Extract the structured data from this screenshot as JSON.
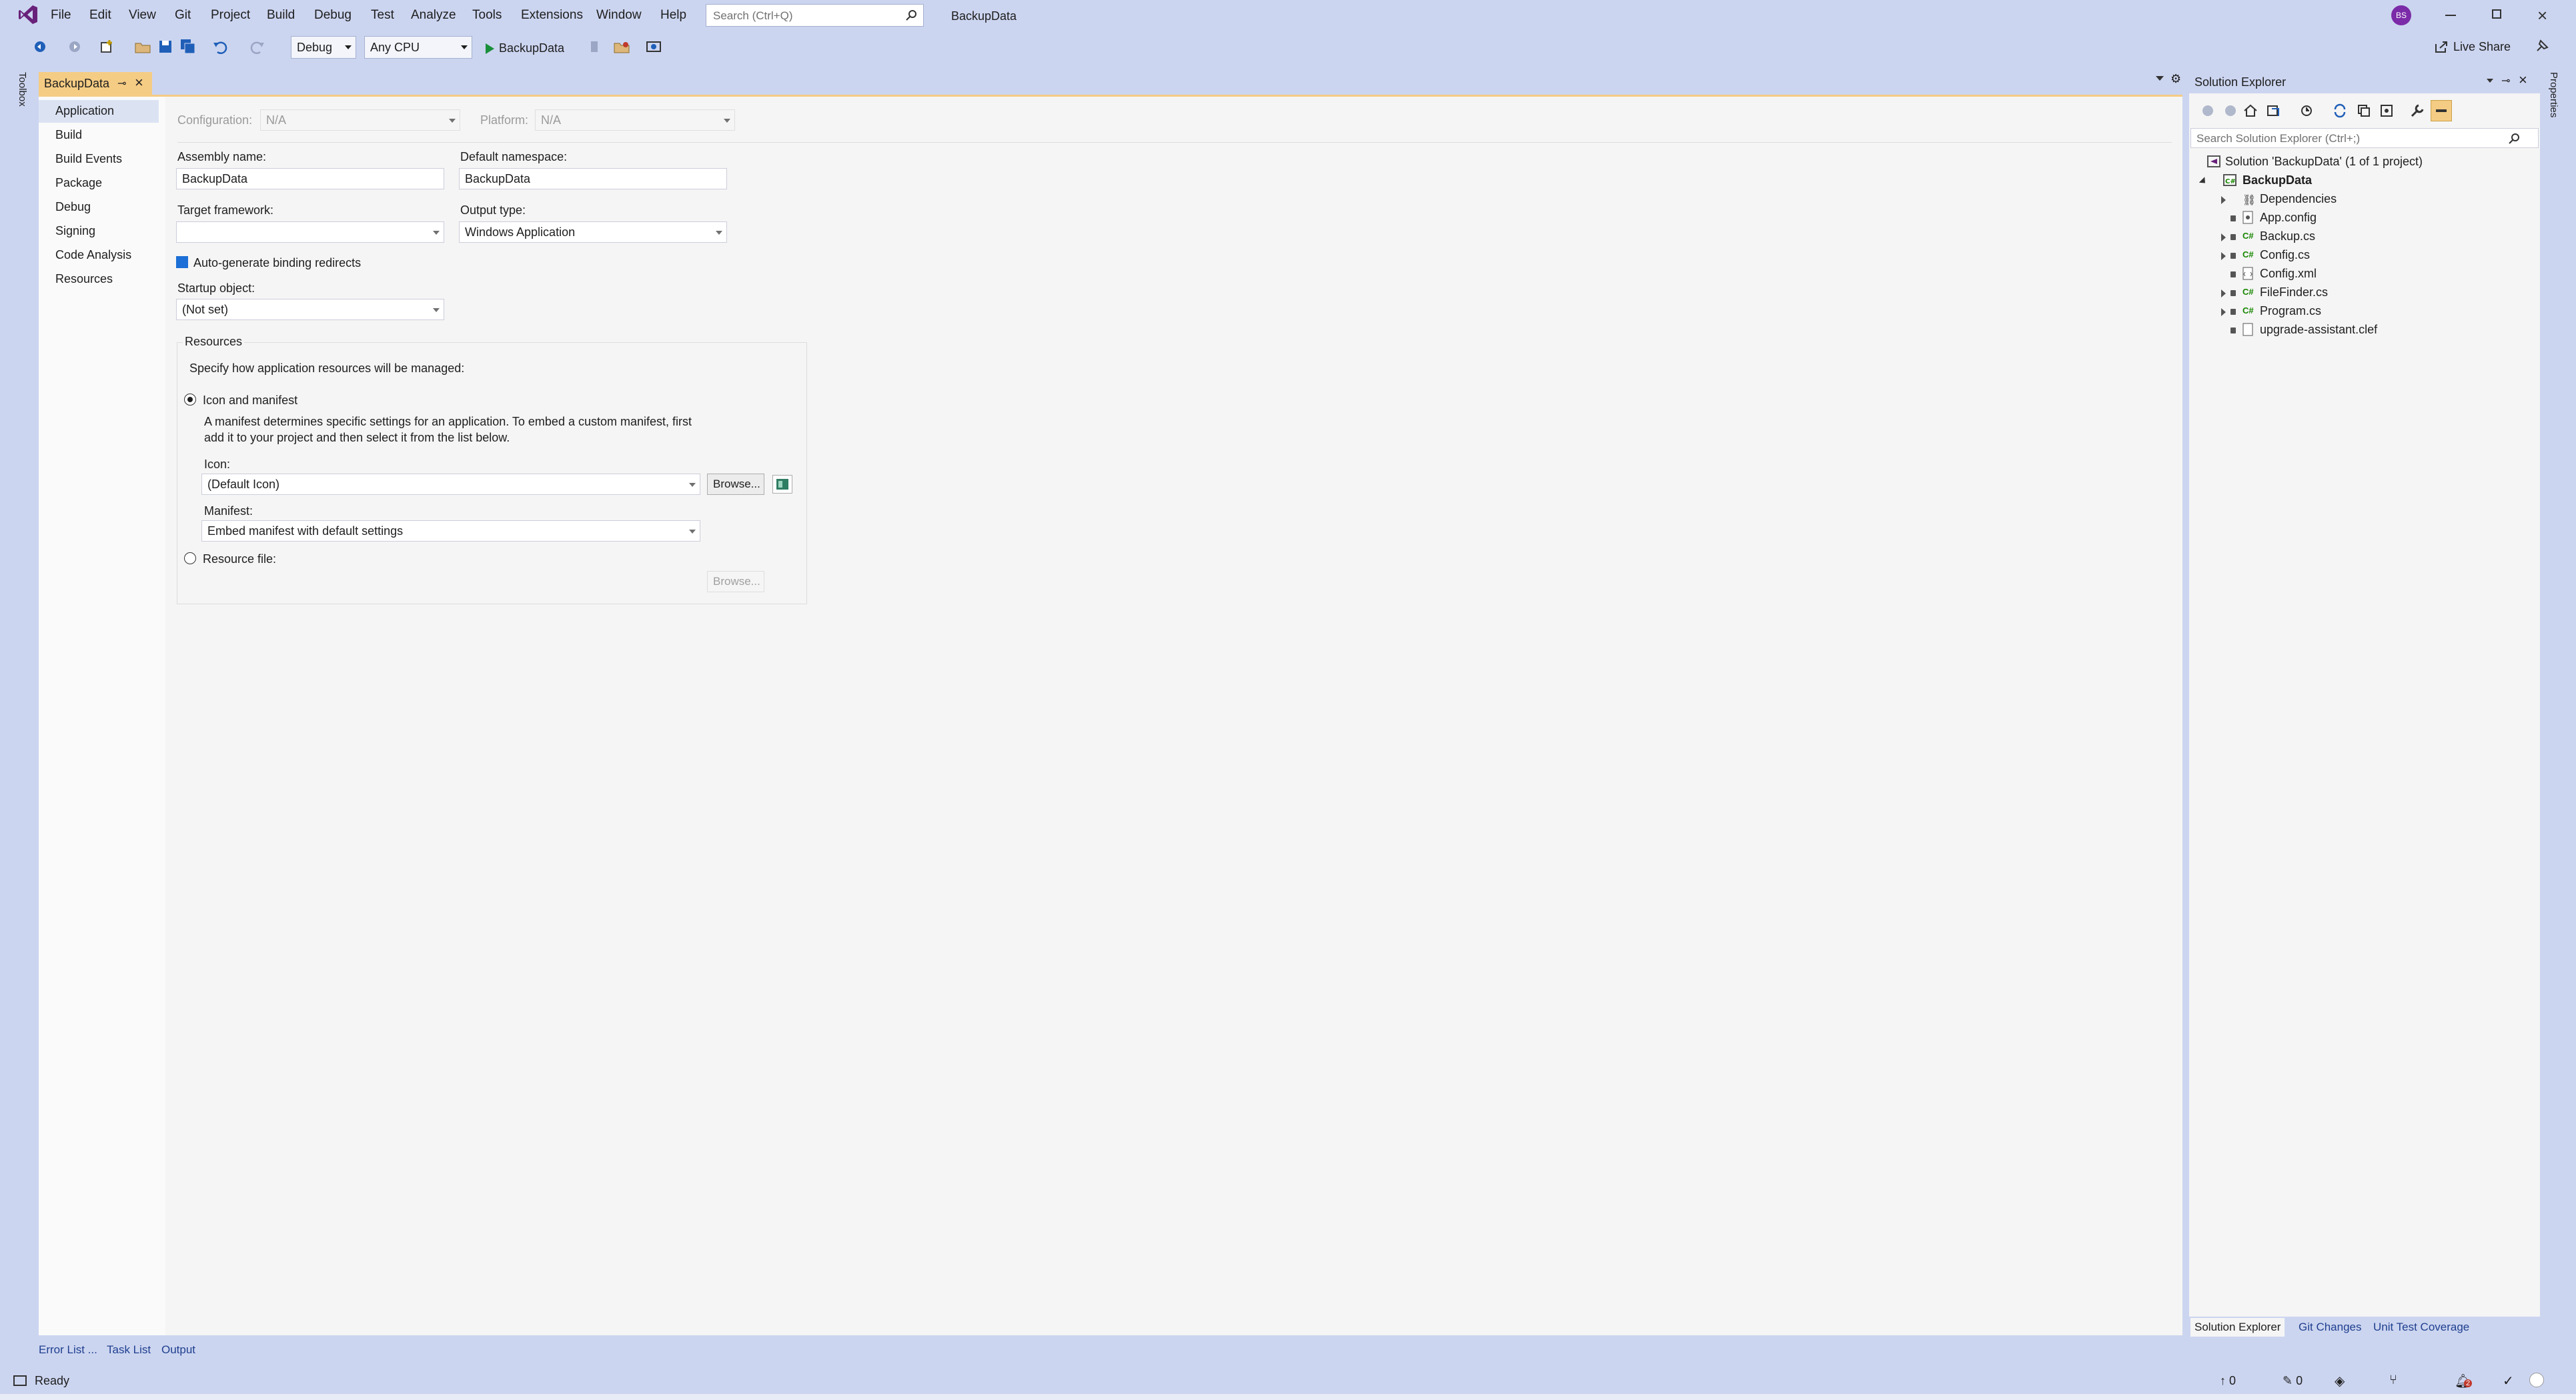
{
  "titlebar": {
    "menu": [
      "File",
      "Edit",
      "View",
      "Git",
      "Project",
      "Build",
      "Debug",
      "Test",
      "Analyze",
      "Tools",
      "Extensions",
      "Window",
      "Help"
    ],
    "search_placeholder": "Search (Ctrl+Q)",
    "solution_name": "BackupData",
    "avatar_initials": "BS",
    "live_share": "Live Share"
  },
  "toolbar": {
    "config": "Debug",
    "platform": "Any CPU",
    "run_target": "BackupData"
  },
  "side_labels": {
    "left": "Toolbox",
    "right": "Properties"
  },
  "document_tab": {
    "title": "BackupData"
  },
  "nav": {
    "items": [
      "Application",
      "Build",
      "Build Events",
      "Package",
      "Debug",
      "Signing",
      "Code Analysis",
      "Resources"
    ],
    "selected": "Application"
  },
  "app": {
    "configuration_label": "Configuration:",
    "configuration_value": "N/A",
    "platform_label": "Platform:",
    "platform_value": "N/A",
    "assembly_name_label": "Assembly name:",
    "assembly_name": "BackupData",
    "default_namespace_label": "Default namespace:",
    "default_namespace": "BackupData",
    "target_framework_label": "Target framework:",
    "target_framework": "",
    "output_type_label": "Output type:",
    "output_type": "Windows Application",
    "auto_binding_label": "Auto-generate binding redirects",
    "startup_object_label": "Startup object:",
    "startup_object": "(Not set)",
    "resources": {
      "title": "Resources",
      "desc": "Specify how application resources will be managed:",
      "icon_manifest_label": "Icon and manifest",
      "manifest_desc_1": "A manifest determines specific settings for an application. To embed a custom manifest, first",
      "manifest_desc_2": "add it to your project and then select it from the list below.",
      "icon_label": "Icon:",
      "icon_value": "(Default Icon)",
      "browse_label": "Browse...",
      "manifest_label": "Manifest:",
      "manifest_value": "Embed manifest with default settings",
      "resource_file_label": "Resource file:",
      "browse2_label": "Browse..."
    }
  },
  "solution_explorer": {
    "title": "Solution Explorer",
    "search_placeholder": "Search Solution Explorer (Ctrl+;)",
    "solution": "Solution 'BackupData' (1 of 1 project)",
    "project": "BackupData",
    "items": [
      "Dependencies",
      "App.config",
      "Backup.cs",
      "Config.cs",
      "Config.xml",
      "FileFinder.cs",
      "Program.cs",
      "upgrade-assistant.clef"
    ],
    "tabs": [
      "Solution Explorer",
      "Git Changes",
      "Unit Test Coverage"
    ]
  },
  "bottom_tabs": [
    "Error List ...",
    "Task List",
    "Output"
  ],
  "status": {
    "text": "Ready",
    "up_count": "0",
    "pencil_count": "0",
    "notif_count": "2"
  },
  "colors": {
    "accent": "#ccd5f0",
    "tab_active": "#f5cc84",
    "vs_purple": "#68217a"
  }
}
